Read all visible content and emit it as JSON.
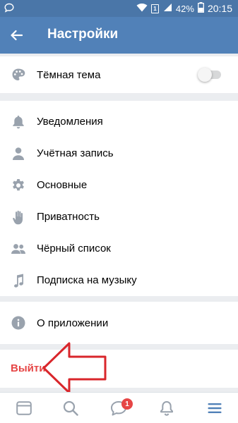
{
  "status_bar": {
    "left_icon": "chat-bubble-icon",
    "icons": [
      "wifi-icon",
      "sim-1-icon",
      "signal-icon",
      "battery-icon"
    ],
    "sim_label": "1",
    "battery": "42%",
    "time": "20:15"
  },
  "header": {
    "back_icon": "arrow-left-icon",
    "title": "Настройки"
  },
  "theme_section": {
    "dark_theme_label": "Тёмная тема",
    "dark_theme_icon": "palette-icon",
    "dark_theme_on": false
  },
  "settings_list": [
    {
      "label": "Уведомления",
      "icon": "bell-icon"
    },
    {
      "label": "Учётная запись",
      "icon": "person-icon"
    },
    {
      "label": "Основные",
      "icon": "gear-icon"
    },
    {
      "label": "Приватность",
      "icon": "hand-icon"
    },
    {
      "label": "Чёрный список",
      "icon": "people-icon"
    },
    {
      "label": "Подписка на музыку",
      "icon": "music-note-icon"
    }
  ],
  "about": {
    "label": "О приложении",
    "icon": "info-icon"
  },
  "logout": {
    "label": "Выйти"
  },
  "bottom_nav": {
    "items": [
      "news-icon",
      "search-icon",
      "messages-icon",
      "notifications-icon",
      "menu-icon"
    ],
    "messages_badge": "1",
    "active": "menu-icon"
  },
  "colors": {
    "header": "#5181b8",
    "status_bar": "#4a76a8",
    "logout": "#e64646",
    "annotation_arrow": "#d9262b",
    "icon_gray": "#99a2ad"
  }
}
